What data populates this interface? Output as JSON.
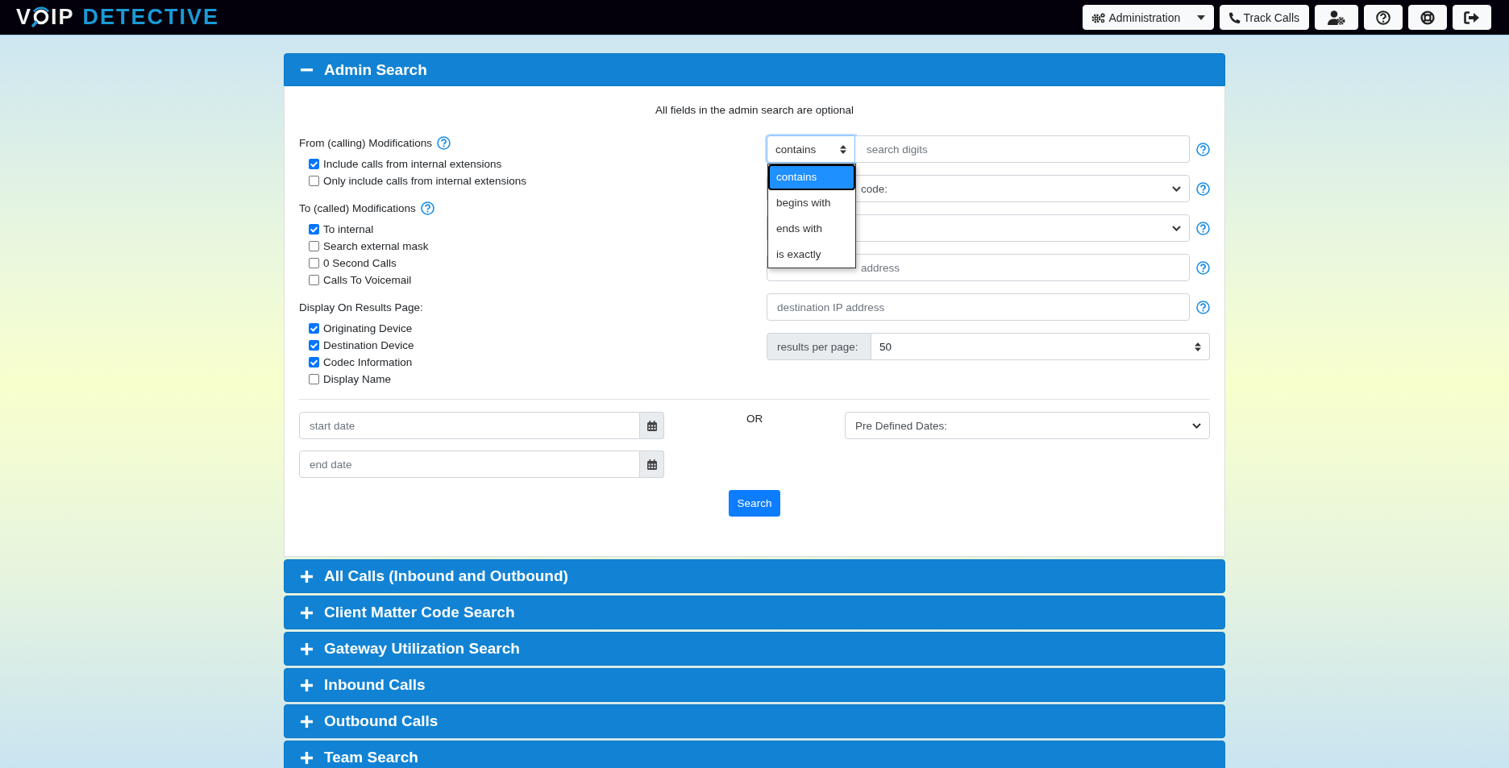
{
  "header": {
    "logo": {
      "first": "V",
      "second": "IP",
      "third": "DETECTIVE"
    },
    "nav_buttons": [
      {
        "kind": "admin",
        "label": "Administration"
      },
      {
        "kind": "track",
        "label": "Track Calls"
      },
      {
        "kind": "user-settings"
      },
      {
        "kind": "help"
      },
      {
        "kind": "support"
      },
      {
        "kind": "logout"
      }
    ]
  },
  "panels": [
    {
      "title": "Admin Search",
      "expanded": true
    },
    {
      "title": "All Calls (Inbound and Outbound)",
      "expanded": false
    },
    {
      "title": "Client Matter Code Search",
      "expanded": false
    },
    {
      "title": "Gateway Utilization Search",
      "expanded": false
    },
    {
      "title": "Inbound Calls",
      "expanded": false
    },
    {
      "title": "Outbound Calls",
      "expanded": false
    },
    {
      "title": "Team Search",
      "expanded": false
    }
  ],
  "admin_search": {
    "note": "All fields in the admin search are optional",
    "sections": [
      {
        "title": "From (calling) Modifications",
        "help": true,
        "options": [
          {
            "label": "Include calls from internal extensions",
            "checked": true
          },
          {
            "label": "Only include calls from internal extensions",
            "checked": false
          }
        ]
      },
      {
        "title": "To (called) Modifications",
        "help": true,
        "options": [
          {
            "label": "To internal",
            "checked": true
          },
          {
            "label": "Search external mask",
            "checked": false
          },
          {
            "label": "0 Second Calls",
            "checked": false
          },
          {
            "label": "Calls To Voicemail",
            "checked": false
          }
        ]
      },
      {
        "title": "Display On Results Page:",
        "help": false,
        "options": [
          {
            "label": "Originating Device",
            "checked": true
          },
          {
            "label": "Destination Device",
            "checked": true
          },
          {
            "label": "Codec Information",
            "checked": true
          },
          {
            "label": "Display Name",
            "checked": false
          }
        ]
      }
    ],
    "filters": [
      {
        "kind": "match",
        "value": "contains",
        "placeholder": "search digits",
        "help": true,
        "open": true,
        "options": [
          {
            "label": "contains",
            "selected": true
          },
          {
            "label": "begins with",
            "selected": false
          },
          {
            "label": "ends with",
            "selected": false
          },
          {
            "label": "is exactly",
            "selected": false
          }
        ]
      },
      {
        "kind": "select",
        "value": "code:",
        "help": true
      },
      {
        "kind": "select",
        "help": true
      },
      {
        "kind": "input",
        "placeholder": "address",
        "help": true
      },
      {
        "kind": "input",
        "placeholder": "destination IP address",
        "help": true
      },
      {
        "kind": "addon-select",
        "label": "results per page:",
        "value": "50"
      }
    ],
    "start_date": {
      "placeholder": "start date"
    },
    "end_date": {
      "placeholder": "end date"
    },
    "or_label": "OR",
    "predefined_dates": {
      "value": "Pre Defined Dates:"
    },
    "search_button": "Search"
  }
}
